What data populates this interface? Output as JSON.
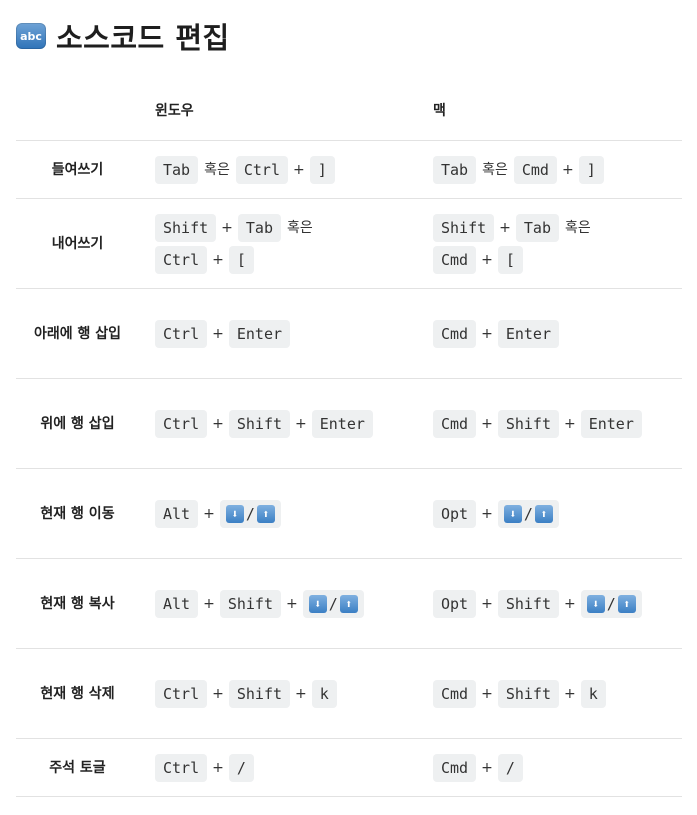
{
  "title": {
    "icon": "abc-input-symbol-icon",
    "icon_text": "abc",
    "text": "소스코드 편집"
  },
  "table": {
    "headers": {
      "action": "",
      "windows": "윈도우",
      "mac": "맥"
    },
    "or_text": "혹은",
    "plus_text": "+",
    "slash_text": "/",
    "arrow_icons": {
      "down": "down-arrow-icon",
      "up": "up-arrow-icon",
      "down_glyph": "⬇",
      "up_glyph": "⬆"
    },
    "rows": [
      {
        "action": "들여쓰기",
        "windows": [
          "Tab",
          "Ctrl",
          "]"
        ],
        "mac": [
          "Tab",
          "Cmd",
          "]"
        ]
      },
      {
        "action": "내어쓰기",
        "windows": [
          "Shift",
          "Tab",
          "Ctrl",
          "["
        ],
        "mac": [
          "Shift",
          "Tab",
          "Cmd",
          "["
        ]
      },
      {
        "action": "아래에 행 삽입",
        "windows": [
          "Ctrl",
          "Enter"
        ],
        "mac": [
          "Cmd",
          "Enter"
        ]
      },
      {
        "action": "위에 행 삽입",
        "windows": [
          "Ctrl",
          "Shift",
          "Enter"
        ],
        "mac": [
          "Cmd",
          "Shift",
          "Enter"
        ]
      },
      {
        "action": "현재 행 이동",
        "windows": [
          "Alt"
        ],
        "mac": [
          "Opt"
        ]
      },
      {
        "action": "현재 행 복사",
        "windows": [
          "Alt",
          "Shift"
        ],
        "mac": [
          "Opt",
          "Shift"
        ]
      },
      {
        "action": "현재 행 삭제",
        "windows": [
          "Ctrl",
          "Shift",
          "k"
        ],
        "mac": [
          "Cmd",
          "Shift",
          "k"
        ]
      },
      {
        "action": "주석 토글",
        "windows": [
          "Ctrl",
          "/"
        ],
        "mac": [
          "Cmd",
          "/"
        ]
      }
    ]
  }
}
